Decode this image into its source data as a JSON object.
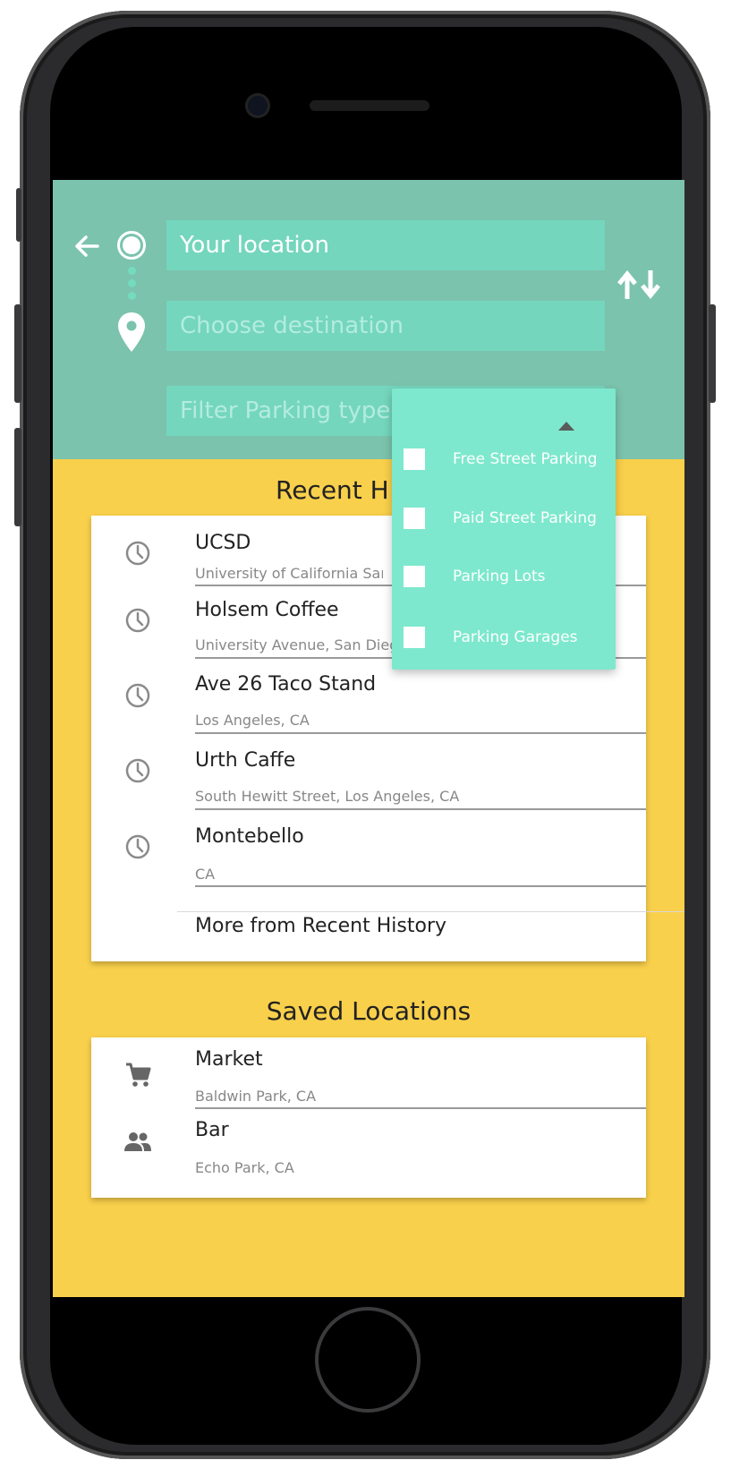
{
  "header": {
    "origin_value": "Your location",
    "destination_placeholder": "Choose destination",
    "filter_placeholder": "Filter Parking type"
  },
  "filter_dropdown": {
    "options": [
      {
        "label": "Free Street Parking",
        "checked": false
      },
      {
        "label": "Paid Street Parking",
        "checked": false
      },
      {
        "label": "Parking Lots",
        "checked": false
      },
      {
        "label": "Parking Garages",
        "checked": false
      }
    ]
  },
  "recent": {
    "title": "Recent H",
    "items": [
      {
        "title": "UCSD",
        "subtitle": "University of California San",
        "icon": "clock-icon"
      },
      {
        "title": "Holsem Coffee",
        "subtitle": "University Avenue, San Diego, CA",
        "icon": "clock-icon"
      },
      {
        "title": "Ave 26 Taco Stand",
        "subtitle": "Los Angeles, CA",
        "icon": "clock-icon"
      },
      {
        "title": "Urth Caffe",
        "subtitle": "South Hewitt Street, Los Angeles, CA",
        "icon": "clock-icon"
      },
      {
        "title": "Montebello",
        "subtitle": "CA",
        "icon": "clock-icon"
      }
    ],
    "more_label": "More from Recent History"
  },
  "saved": {
    "title": "Saved Locations",
    "items": [
      {
        "title": "Market",
        "subtitle": "Baldwin Park, CA",
        "icon": "cart-icon"
      },
      {
        "title": "Bar",
        "subtitle": "Echo Park, CA",
        "icon": "people-icon"
      }
    ]
  },
  "colors": {
    "header_bg": "#7bc3ad",
    "field_bg": "#74d6bd",
    "dropdown_bg": "#7de8cd",
    "content_bg": "#f9d04b"
  }
}
